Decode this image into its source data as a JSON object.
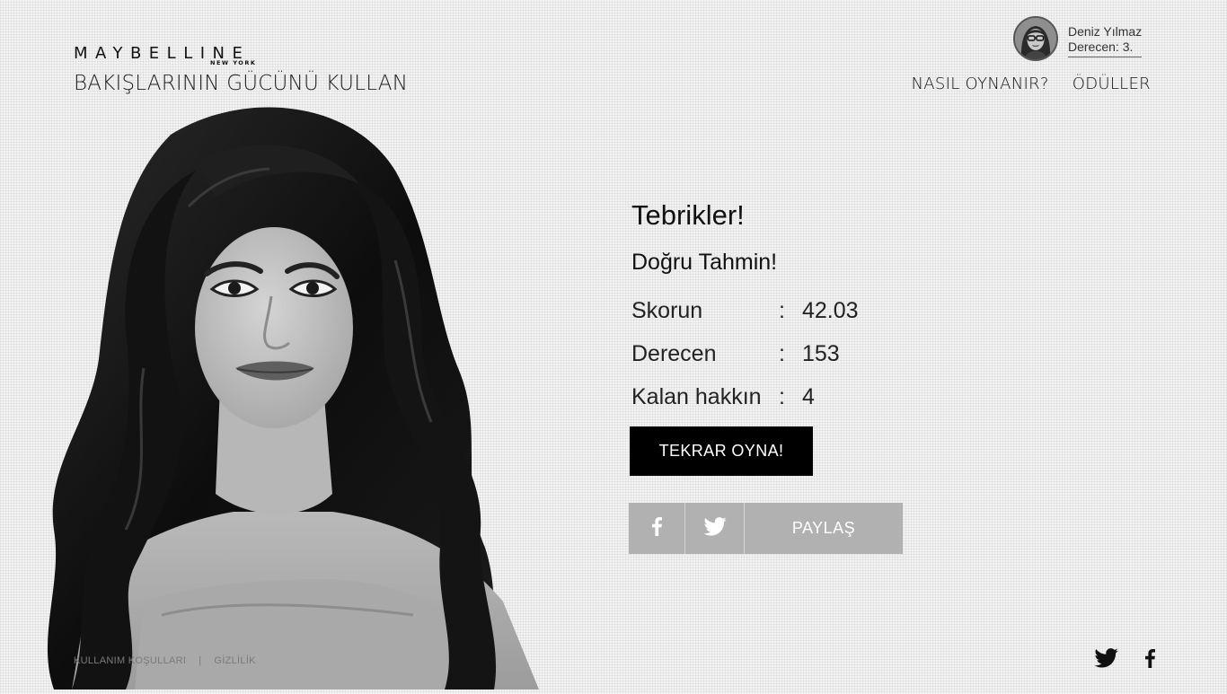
{
  "brand": {
    "logo_text": "MAYBELLINE",
    "logo_sub": "NEW YORK",
    "tagline": "BAKIŞLARININ GÜCÜNÜ KULLAN"
  },
  "user": {
    "name": "Deniz Yılmaz",
    "rank": "Derecen: 3."
  },
  "nav": {
    "how_to_play": "NASIL OYNANIR?",
    "rewards": "ÖDÜLLER"
  },
  "result": {
    "title": "Tebrikler!",
    "subtitle": "Doğru Tahmin!",
    "stats": [
      {
        "label": "Skorun",
        "colon": ":",
        "value": "42.03"
      },
      {
        "label": "Derecen",
        "colon": ":",
        "value": "153"
      },
      {
        "label": "Kalan hakkın",
        "colon": ":",
        "value": "4"
      }
    ],
    "play_again": "TEKRAR OYNA!",
    "share_label": "PAYLAŞ"
  },
  "footer": {
    "terms": "KULLANIM KOŞULLARI",
    "separator": "|",
    "privacy": "GİZLİLİK"
  },
  "icons": {
    "share_facebook": "facebook-icon",
    "share_twitter": "twitter-icon",
    "footer_twitter": "twitter-icon",
    "footer_facebook": "facebook-icon"
  },
  "colors": {
    "background": "#f3f3f3",
    "primary_button": "#000000",
    "share_bar": "#b1b1b1"
  }
}
